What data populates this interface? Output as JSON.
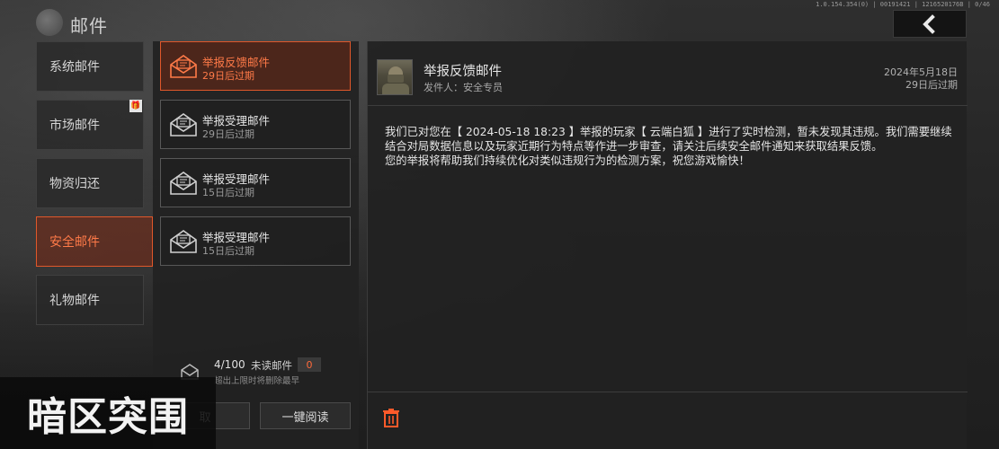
{
  "header": {
    "title": "邮件",
    "version": "1.0.154.354(0) | 00191421 | 1216520176B | 0/46",
    "back_icon": "chevron-left-icon"
  },
  "categories": [
    {
      "label": "系统邮件",
      "active": false
    },
    {
      "label": "市场邮件",
      "active": false,
      "badge_icon": "gift-icon",
      "badge_glyph": "🎁"
    },
    {
      "label": "物资归还",
      "active": false
    },
    {
      "label": "安全邮件",
      "active": true
    },
    {
      "label": "礼物邮件",
      "active": false
    }
  ],
  "mail_list": [
    {
      "title": "举报反馈邮件",
      "expire": "29日后过期",
      "active": true,
      "icon": "envelope-open-icon"
    },
    {
      "title": "举报受理邮件",
      "expire": "29日后过期",
      "active": false,
      "icon": "envelope-open-icon"
    },
    {
      "title": "举报受理邮件",
      "expire": "15日后过期",
      "active": false,
      "icon": "envelope-open-icon"
    },
    {
      "title": "举报受理邮件",
      "expire": "15日后过期",
      "active": false,
      "icon": "envelope-open-icon"
    }
  ],
  "mail_count": {
    "count": "4/100",
    "unread_label": "未读邮件",
    "unread": "0",
    "hint": "超出上限时将删除最早"
  },
  "list_buttons": {
    "delete_read": "取",
    "read_all": "一键阅读"
  },
  "detail": {
    "title": "举报反馈邮件",
    "sender": "发件人：安全专员",
    "date": "2024年5月18日",
    "expire": "29日后过期",
    "body": "我们已对您在【 2024-05-18 18:23 】举报的玩家【 云端白狐 】进行了实时检测，暂未发现其违规。我们需要继续结合对局数据信息以及玩家近期行为特点等作进一步审查，请关注后续安全邮件通知来获取结果反馈。\n您的举报将帮助我们持续优化对类似违规行为的检测方案，祝您游戏愉快！",
    "trash_icon": "trash-icon"
  },
  "watermark": "暗区突围",
  "colors": {
    "accent": "#e0572a",
    "accent_text": "#ff7a48",
    "panel": "#222222",
    "background": "#1c1c1c"
  }
}
